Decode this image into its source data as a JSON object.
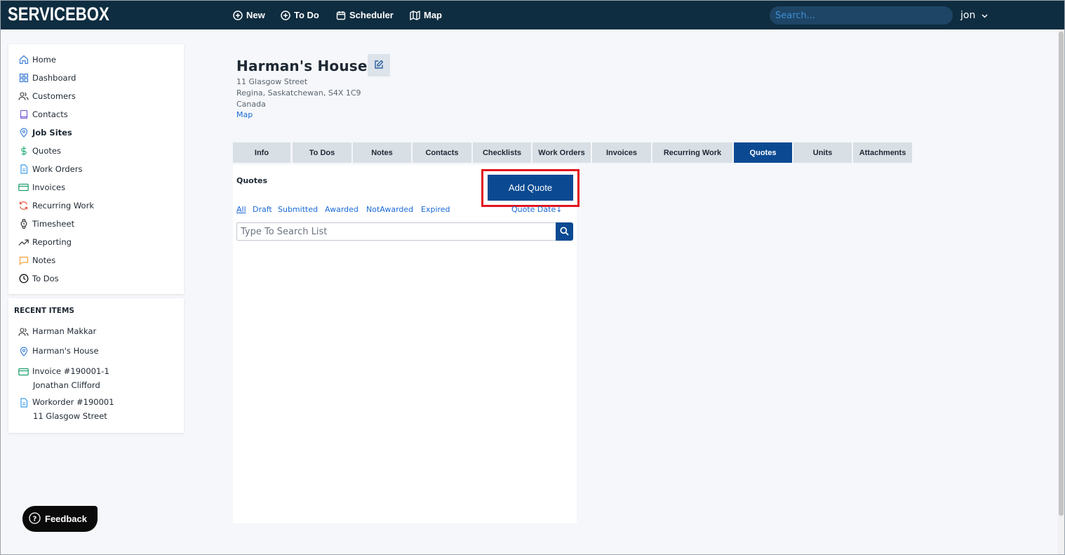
{
  "app": {
    "logo": "SERVICEBOX"
  },
  "topnav": {
    "new_label": "New",
    "todo_label": "To Do",
    "scheduler_label": "Scheduler",
    "map_label": "Map",
    "search_placeholder": "Search...",
    "user_name": "jon"
  },
  "sidebar": {
    "items": [
      {
        "label": "Home",
        "icon": "home-icon"
      },
      {
        "label": "Dashboard",
        "icon": "dashboard-icon"
      },
      {
        "label": "Customers",
        "icon": "users-icon"
      },
      {
        "label": "Contacts",
        "icon": "book-icon"
      },
      {
        "label": "Job Sites",
        "icon": "location-pin-icon"
      },
      {
        "label": "Quotes",
        "icon": "dollar-icon"
      },
      {
        "label": "Work Orders",
        "icon": "document-icon"
      },
      {
        "label": "Invoices",
        "icon": "credit-card-icon"
      },
      {
        "label": "Recurring Work",
        "icon": "refresh-icon"
      },
      {
        "label": "Timesheet",
        "icon": "watch-icon"
      },
      {
        "label": "Reporting",
        "icon": "trending-up-icon"
      },
      {
        "label": "Notes",
        "icon": "chat-bubble-icon"
      },
      {
        "label": "To Dos",
        "icon": "clock-icon"
      }
    ],
    "active_item": "Job Sites"
  },
  "recent": {
    "title": "RECENT ITEMS",
    "items": [
      {
        "label": "Harman Makkar",
        "sub": ""
      },
      {
        "label": "Harman's House",
        "sub": ""
      },
      {
        "label": "Invoice #190001-1",
        "sub": "Jonathan Clifford"
      },
      {
        "label": "Workorder #190001",
        "sub": "11 Glasgow Street"
      }
    ]
  },
  "site": {
    "title": "Harman's House",
    "address_line1": "11 Glasgow Street",
    "address_line2": "Regina, Saskatchewan, S4X 1C9",
    "address_line3": "Canada",
    "map_link": "Map"
  },
  "tabs": [
    "Info",
    "To Dos",
    "Notes",
    "Contacts",
    "Checklists",
    "Work Orders",
    "Invoices",
    "Recurring Work",
    "Quotes",
    "Units",
    "Attachments"
  ],
  "active_tab": "Quotes",
  "quotes": {
    "title": "Quotes",
    "add_button": "Add Quote",
    "filters": [
      "All",
      "Draft",
      "Submitted",
      "Awarded",
      "NotAwarded",
      "Expired"
    ],
    "active_filter": "All",
    "sort_label": "Quote Date",
    "search_placeholder": "Type To Search List"
  },
  "feedback": {
    "label": "Feedback"
  },
  "colors": {
    "topbar": "#0f2d40",
    "accent": "#0b4a92",
    "link": "#1a6ad6",
    "highlight": "#e2141f"
  }
}
